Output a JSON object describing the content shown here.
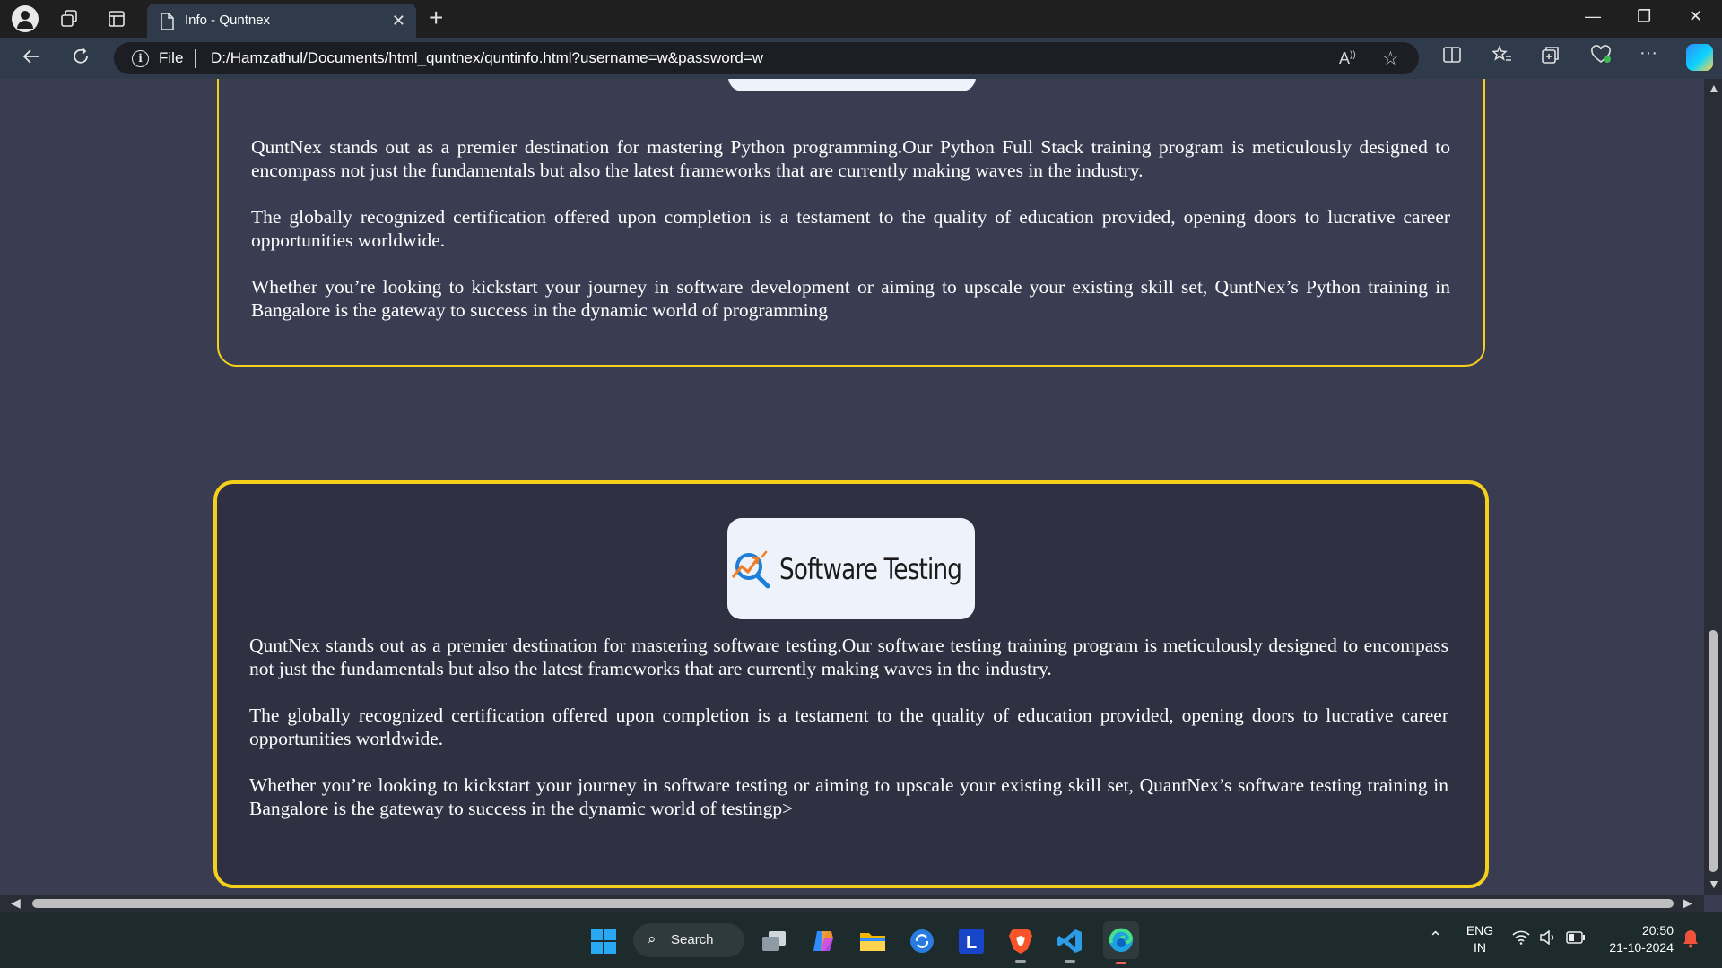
{
  "browser": {
    "tab_title": "Info - Quntnex",
    "tab_close": "✕",
    "new_tab": "+",
    "win_minimize": "—",
    "win_restore": "❐",
    "win_close": "✕",
    "address_label": "File",
    "url": "D:/Hamzathul/Documents/html_quntnex/quntinfo.html?username=w&password=w"
  },
  "sections": [
    {
      "paragraphs": [
        "QuntNex stands out as a premier destination for mastering Python programming.Our Python Full Stack training program is meticulously designed to encompass not just the fundamentals but also the latest frameworks that are currently making waves in the industry.",
        "The globally recognized certification offered upon completion is a testament to the quality of education provided, opening doors to lucrative career opportunities worldwide.",
        "Whether you’re looking to kickstart your journey in software development or aiming to upscale your existing skill set, QuntNex’s Python training in Bangalore is the gateway to success in the dynamic world of programming"
      ]
    },
    {
      "badge_title": "Software Testing",
      "badge_icon": "magnifier-chart-icon",
      "paragraphs": [
        "QuntNex stands out as a premier destination for mastering software testing.Our software testing training program is meticulously designed to encompass not just the fundamentals but also the latest frameworks that are currently making waves in the industry.",
        "The globally recognized certification offered upon completion is a testament to the quality of education provided, opening doors to lucrative career opportunities worldwide.",
        "Whether you’re looking to kickstart your journey in software testing or aiming to upscale your existing skill set, QuantNex’s software testing training in Bangalore is the gateway to success in the dynamic world of testingp>"
      ]
    }
  ],
  "taskbar": {
    "search_label": "Search",
    "language": "ENG",
    "region": "IN",
    "time": "20:50",
    "date": "21-10-2024"
  },
  "colors": {
    "accent_border": "#f4d01a",
    "page_background": "#3a3d52",
    "card_background": "#2f3142",
    "badge_background": "#eef3fb"
  }
}
